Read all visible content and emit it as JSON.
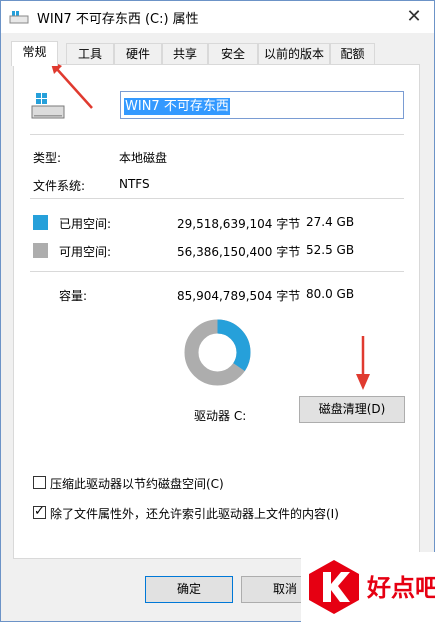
{
  "window": {
    "title": "WIN7 不可存东西 (C:) 属性",
    "close_glyph": "✕"
  },
  "tabs": [
    {
      "label": "常规",
      "active": true
    },
    {
      "label": "工具"
    },
    {
      "label": "硬件"
    },
    {
      "label": "共享"
    },
    {
      "label": "安全"
    },
    {
      "label": "以前的版本"
    },
    {
      "label": "配额"
    }
  ],
  "general": {
    "drive_name": "WIN7 不可存东西",
    "type_label": "类型:",
    "type_value": "本地磁盘",
    "fs_label": "文件系统:",
    "fs_value": "NTFS",
    "used_label": "已用空间:",
    "used_bytes": "29,518,639,104 字节",
    "used_size": "27.4 GB",
    "free_label": "可用空间:",
    "free_bytes": "56,386,150,400 字节",
    "free_size": "52.5 GB",
    "capacity_label": "容量:",
    "capacity_bytes": "85,904,789,504 字节",
    "capacity_size": "80.0 GB",
    "drive_label": "驱动器 C:",
    "cleanup_button": "磁盘清理(D)",
    "compress_label": "压缩此驱动器以节约磁盘空间(C)",
    "compress_checked": false,
    "index_label": "除了文件属性外，还允许索引此驱动器上文件的内容(I)",
    "index_checked": true,
    "used_fraction": 0.344
  },
  "footer": {
    "ok_button": "确定",
    "cancel_button": "取消"
  },
  "watermark": {
    "text": "好点吧"
  },
  "colors": {
    "used": "#26a0da",
    "free": "#adadad",
    "annotation_arrow": "#e03a2f",
    "brand": "#e60012"
  },
  "icons": [
    "drive-icon",
    "windows-logo-icon",
    "close-icon",
    "checkmark-icon",
    "arrow-annotation-icon"
  ]
}
